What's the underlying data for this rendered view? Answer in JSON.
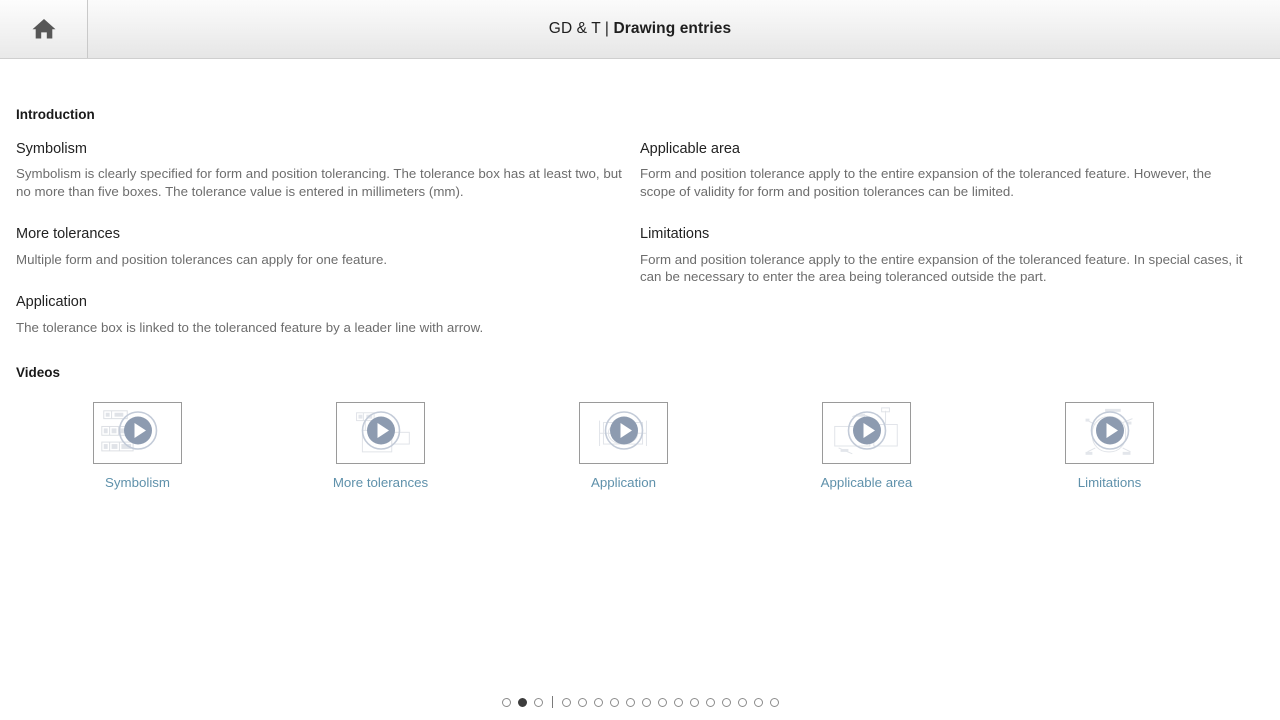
{
  "header": {
    "home_icon": "home-icon",
    "title_prefix": "GD & T | ",
    "title_main": "Drawing entries"
  },
  "main": {
    "intro_title": "Introduction",
    "videos_title": "Videos",
    "left_entries": [
      {
        "heading": "Symbolism",
        "body": "Symbolism is clearly specified for form and position tolerancing. The tolerance box has at least two, but no more than five boxes. The tolerance value is entered in millimeters (mm)."
      },
      {
        "heading": "More tolerances",
        "body": "Multiple form and position tolerances can apply for one feature."
      },
      {
        "heading": "Application",
        "body": "The tolerance box is linked to the toleranced feature by a leader line with arrow."
      }
    ],
    "right_entries": [
      {
        "heading": "Applicable area",
        "body": "Form and position tolerance apply to the entire expansion of the toleranced feature. However, the scope of validity for form and position tolerances can be limited."
      },
      {
        "heading": "Limitations",
        "body": "Form and position tolerance apply to the entire expansion of the toleranced feature. In special cases, it can be necessary to enter the area being toleranced outside the part."
      }
    ],
    "videos": [
      {
        "caption": "Symbolism",
        "play_icon": "play-icon",
        "sketch": "tolerance-boxes-sketch"
      },
      {
        "caption": "More tolerances",
        "play_icon": "play-icon",
        "sketch": "multiple-tolerance-sketch"
      },
      {
        "caption": "Application",
        "play_icon": "play-icon",
        "sketch": "leader-line-sketch"
      },
      {
        "caption": "Applicable area",
        "play_icon": "play-icon",
        "sketch": "applicable-area-sketch"
      },
      {
        "caption": "Limitations",
        "play_icon": "play-icon",
        "sketch": "limitations-circle-sketch"
      }
    ]
  },
  "pager": {
    "total_dots": 17,
    "active_index": 1,
    "separator_after_index": 2
  },
  "colors": {
    "caption_link": "#5f91ab",
    "play_button": "#8d9bb0",
    "body_text": "#6d6d6d",
    "heading_text": "#222222"
  }
}
